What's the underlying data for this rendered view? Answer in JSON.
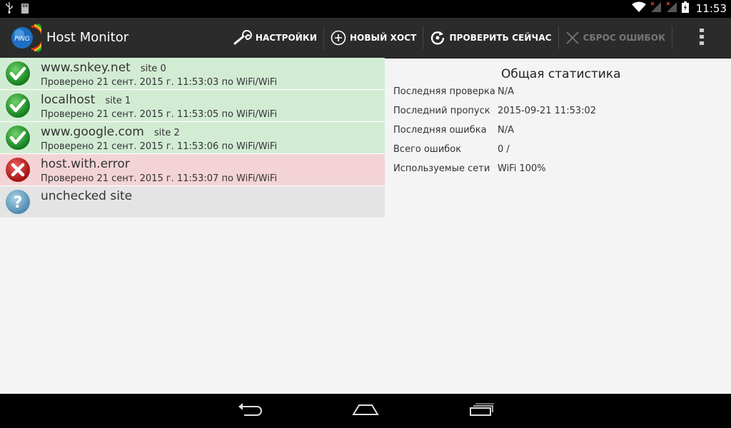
{
  "status_bar": {
    "time": "11:53",
    "icons": [
      "usb-icon",
      "sd-card-icon",
      "wifi-icon",
      "signal-icon",
      "signal-icon",
      "battery-icon"
    ]
  },
  "app": {
    "title": "Host Monitor",
    "logo_text": "PING"
  },
  "actions": [
    {
      "label": "НАСТРОЙКИ",
      "icon": "wrench-icon",
      "enabled": true
    },
    {
      "label": "НОВЫЙ ХОСТ",
      "icon": "plus-circle-icon",
      "enabled": true
    },
    {
      "label": "ПРОВЕРИТЬ СЕЙЧАС",
      "icon": "refresh-icon",
      "enabled": true
    },
    {
      "label": "СБРОС ОШИБОК",
      "icon": "close-icon",
      "enabled": false
    }
  ],
  "hosts": [
    {
      "name": "www.snkey.net",
      "label": "site 0",
      "status": "Проверено 21 сент. 2015 г. 11:53:03 по WiFi/WiFi",
      "state": "ok"
    },
    {
      "name": "localhost",
      "label": "site 1",
      "status": "Проверено 21 сент. 2015 г. 11:53:05 по WiFi/WiFi",
      "state": "ok"
    },
    {
      "name": "www.google.com",
      "label": "site 2",
      "status": "Проверено 21 сент. 2015 г. 11:53:06 по WiFi/WiFi",
      "state": "ok"
    },
    {
      "name": "host.with.error",
      "label": "",
      "status": "Проверено 21 сент. 2015 г. 11:53:07 по WiFi/WiFi",
      "state": "error"
    },
    {
      "name": "unchecked site",
      "label": "",
      "status": "",
      "state": "unknown"
    }
  ],
  "stats": {
    "title": "Общая статистика",
    "rows": [
      {
        "key": "Последняя проверка",
        "value": "N/A"
      },
      {
        "key": "Последний пропуск",
        "value": "2015-09-21 11:53:02"
      },
      {
        "key": "Последняя ошибка",
        "value": "N/A"
      },
      {
        "key": "Всего ошибок",
        "value": "0 /"
      },
      {
        "key": "Используемые сети",
        "value": "WiFi 100%"
      }
    ]
  },
  "colors": {
    "ok_row": "#d2ecd4",
    "error_row": "#f3d3d6",
    "unknown_row": "#e4e4e4",
    "action_bar": "#2b2b2b"
  }
}
